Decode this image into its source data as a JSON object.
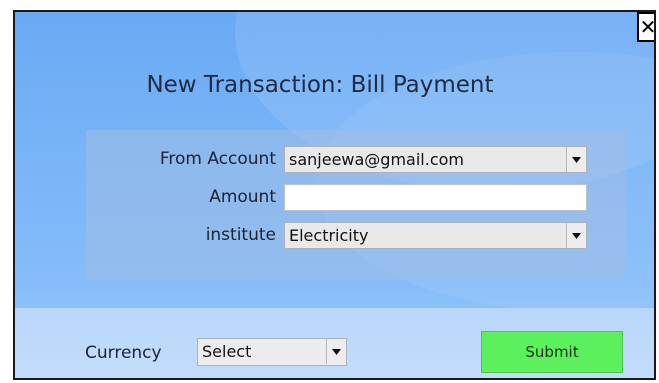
{
  "dialog": {
    "title": "New Transaction: Bill Payment",
    "close_label": "✕"
  },
  "form": {
    "from_account": {
      "label": "From Account",
      "selected": "sanjeewa@gmail.com"
    },
    "amount": {
      "label": "Amount",
      "value": ""
    },
    "institute": {
      "label": "institute",
      "selected": "Electricity"
    }
  },
  "footer": {
    "currency": {
      "label": "Currency",
      "selected": "Select"
    },
    "submit_label": "Submit"
  },
  "colors": {
    "background_top": "#6aa9f4",
    "background_bottom": "#9cccfb",
    "submit_green": "#5cf05c"
  }
}
